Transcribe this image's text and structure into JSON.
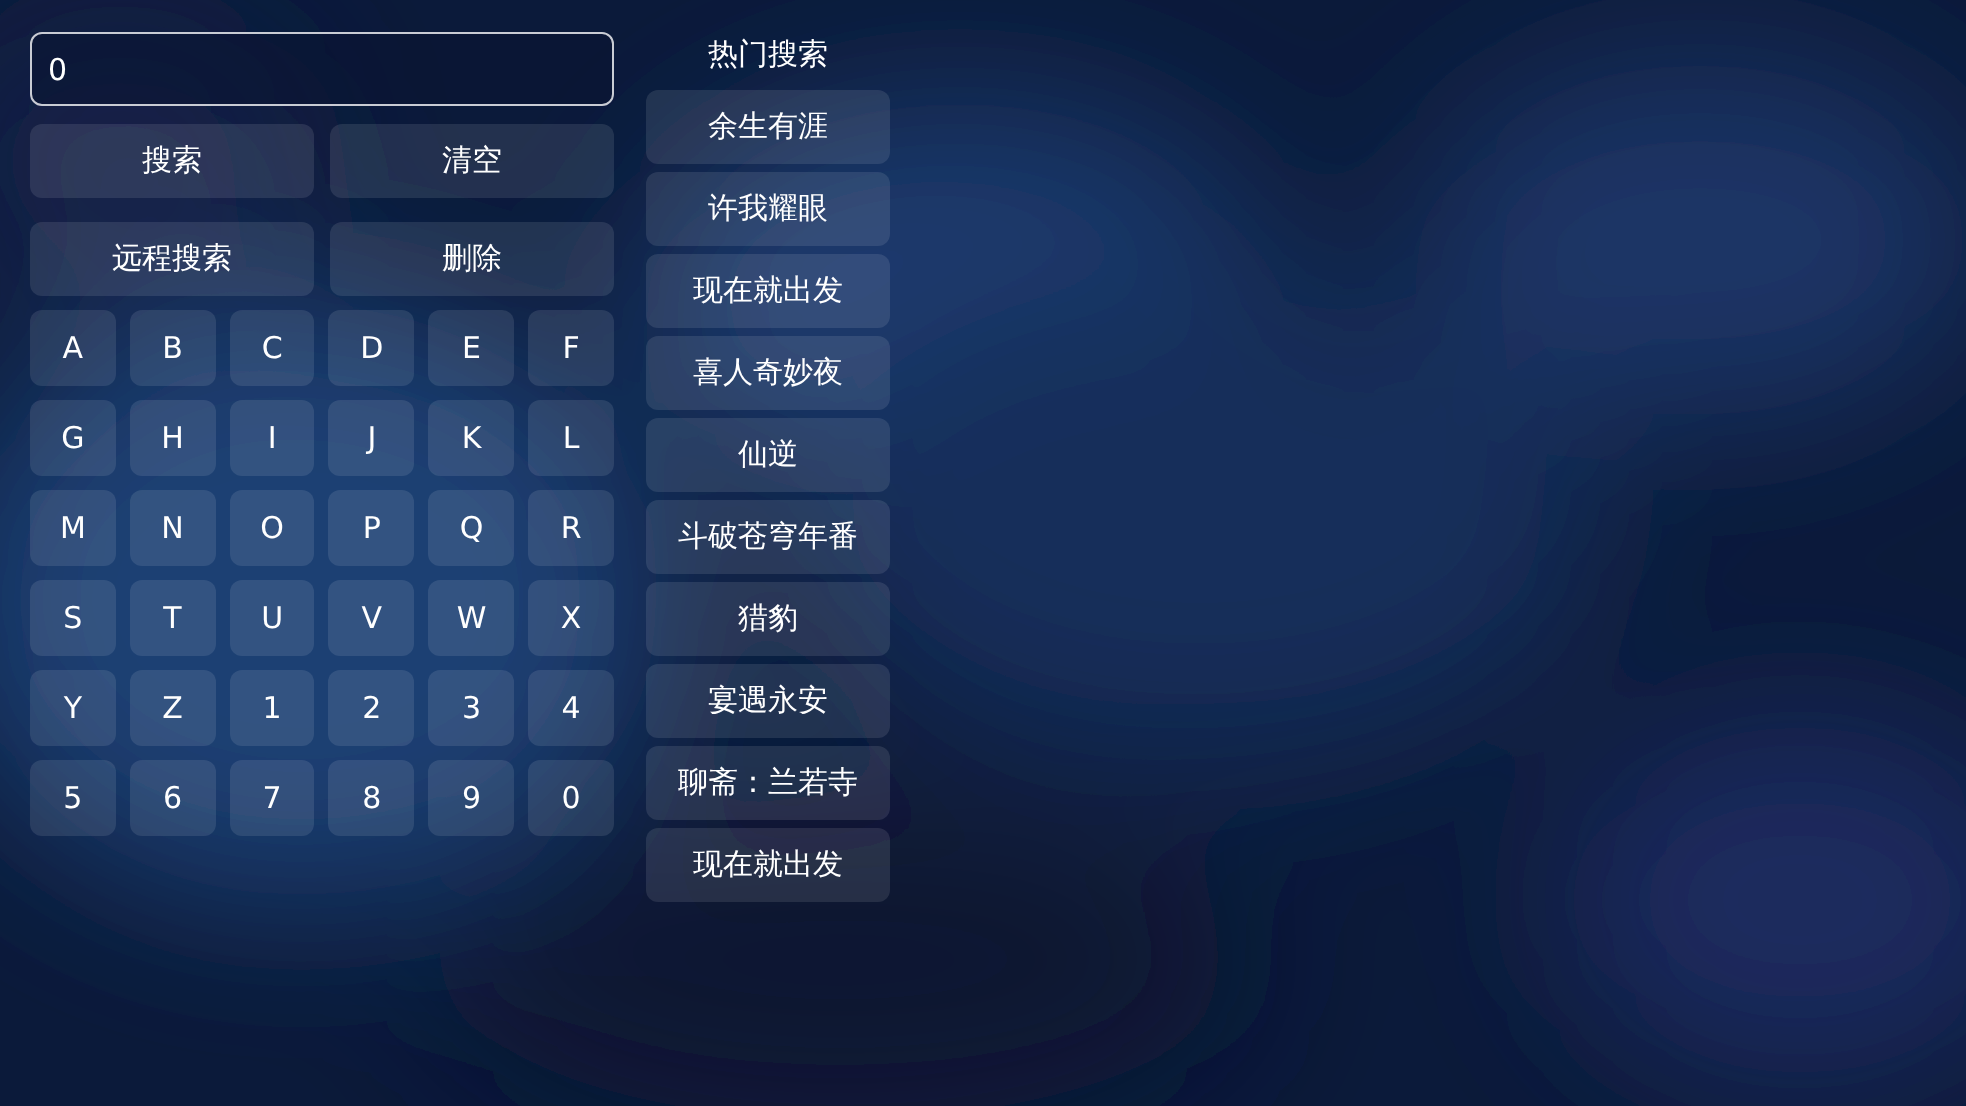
{
  "search": {
    "value": "0"
  },
  "actions": [
    "搜索",
    "清空",
    "远程搜索",
    "删除"
  ],
  "keys": [
    "A",
    "B",
    "C",
    "D",
    "E",
    "F",
    "G",
    "H",
    "I",
    "J",
    "K",
    "L",
    "M",
    "N",
    "O",
    "P",
    "Q",
    "R",
    "S",
    "T",
    "U",
    "V",
    "W",
    "X",
    "Y",
    "Z",
    "1",
    "2",
    "3",
    "4",
    "5",
    "6",
    "7",
    "8",
    "9",
    "0"
  ],
  "hot_search": {
    "title": "热门搜索",
    "items": [
      "余生有涯",
      "许我耀眼",
      "现在就出发",
      "喜人奇妙夜",
      "仙逆",
      "斗破苍穹年番",
      "猎豹",
      "宴遇永安",
      "聊斋：兰若寺",
      "现在就出发"
    ]
  }
}
